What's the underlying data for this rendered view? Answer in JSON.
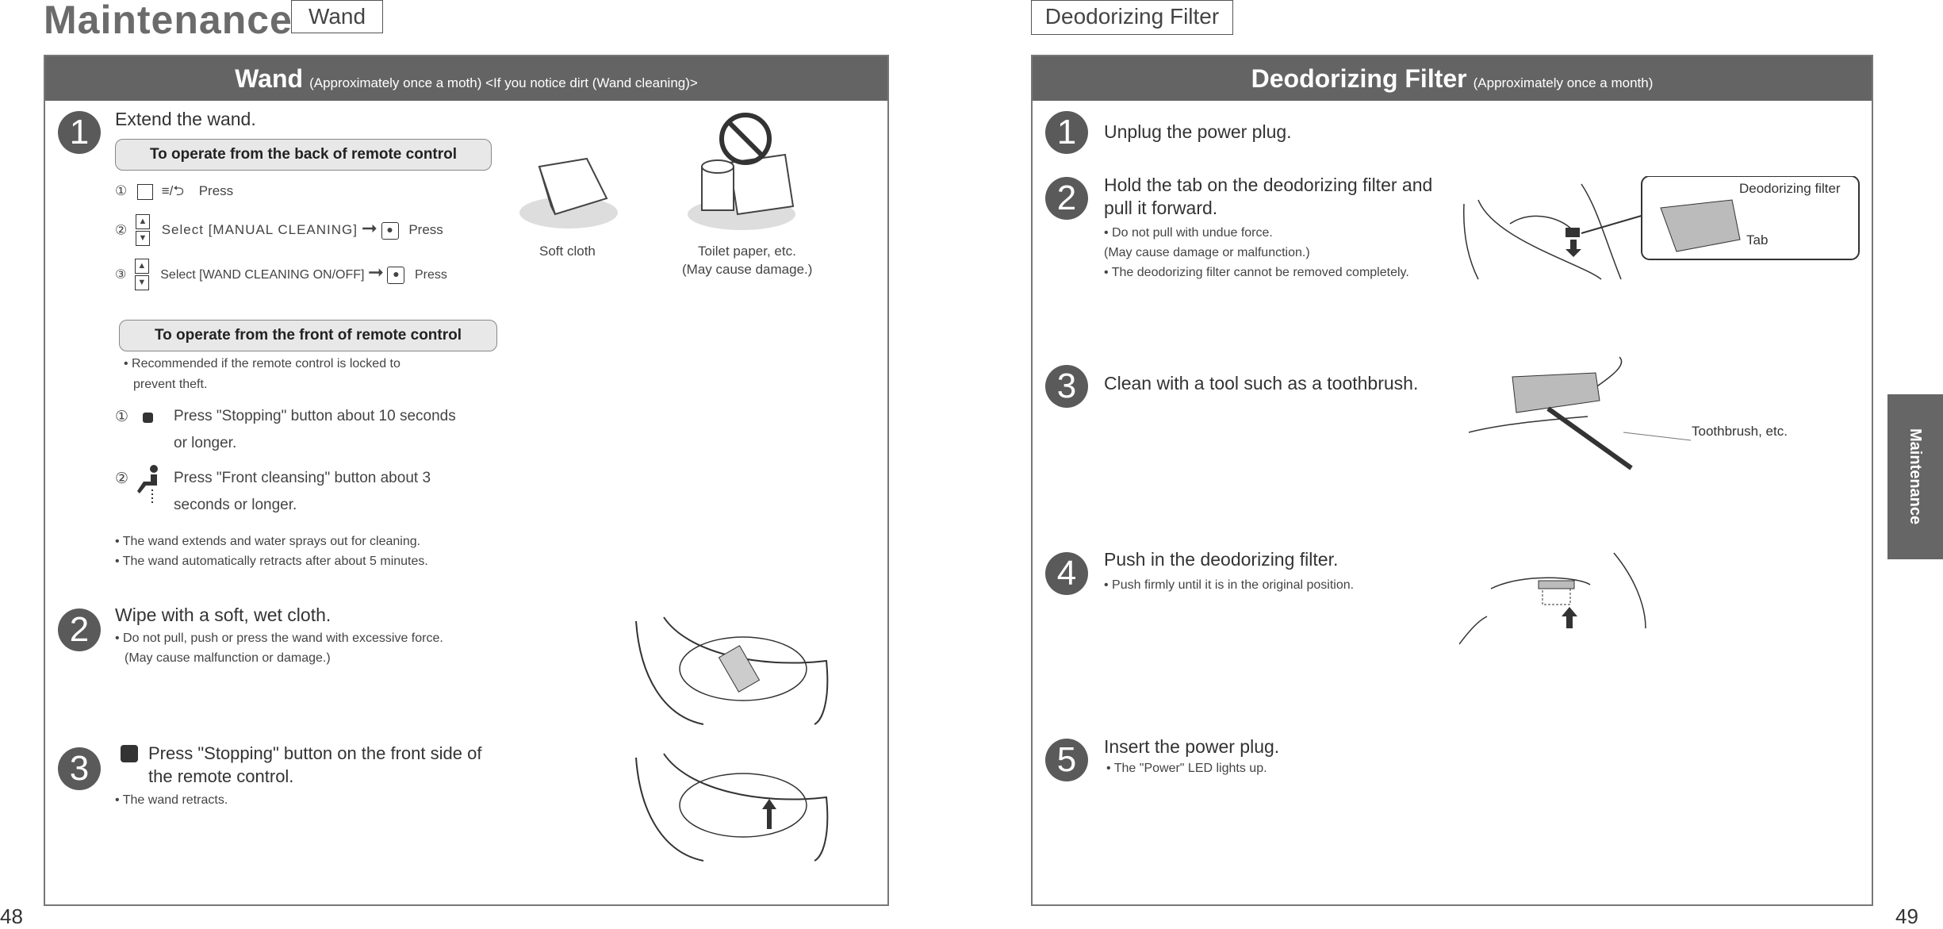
{
  "left_page": {
    "section_title": "Maintenance",
    "tag": "Wand",
    "page_number": "48",
    "header": {
      "title": "Wand",
      "subtitle": "(Approximately once a moth) <If you notice dirt (Wand cleaning)>"
    },
    "step1": {
      "number": "1",
      "title": "Extend the wand.",
      "back_pill": "To operate from the back of remote control",
      "back_rows": [
        {
          "marker": "①",
          "symbol": "≡/⮌",
          "text": "Press"
        },
        {
          "marker": "②",
          "text": "Select [MANUAL CLEANING]",
          "press": "Press"
        },
        {
          "marker": "③",
          "text": "Select [WAND CLEANING ON/OFF]",
          "press": "Press"
        }
      ],
      "soft_cloth_label": "Soft cloth",
      "toilet_paper_label": "Toilet paper, etc.",
      "toilet_paper_note": "(May cause damage.)",
      "front_pill": "To operate from the front of remote control",
      "front_note_1": "• Recommended if the remote control is locked to",
      "front_note_2": "prevent theft.",
      "front_rows": [
        {
          "marker": "①",
          "line1": "Press \"Stopping\" button about 10 seconds",
          "line2": "or longer."
        },
        {
          "marker": "②",
          "line1": "Press \"Front cleansing\" button about 3",
          "line2": "seconds or longer."
        }
      ],
      "bullets": [
        "• The wand extends and water sprays out for cleaning.",
        "• The wand automatically retracts after about 5 minutes."
      ]
    },
    "step2": {
      "number": "2",
      "title": "Wipe with a soft, wet cloth.",
      "bullet1": "• Do not pull, push or press the wand with excessive force.",
      "bullet2": "(May cause malfunction or damage.)"
    },
    "step3": {
      "number": "3",
      "title_line1": "Press \"Stopping\" button on the front side of",
      "title_line2": "the remote control.",
      "bullet": "• The wand retracts."
    }
  },
  "right_page": {
    "tag": "Deodorizing Filter",
    "page_number": "49",
    "side_tab": "Maintenance",
    "header": {
      "title": "Deodorizing Filter",
      "subtitle": "(Approximately once a month)"
    },
    "steps": [
      {
        "number": "1",
        "title": "Unplug the power plug."
      },
      {
        "number": "2",
        "title_line1": "Hold the tab on the deodorizing filter and",
        "title_line2": "pull it forward.",
        "bullets": [
          "• Do not pull with undue force.",
          " (May cause damage or malfunction.)",
          "• The deodorizing filter cannot be removed completely."
        ],
        "callout_filter": "Deodorizing filter",
        "callout_tab": "Tab"
      },
      {
        "number": "3",
        "title": "Clean with a tool such as a toothbrush.",
        "label": "Toothbrush, etc."
      },
      {
        "number": "4",
        "title": "Push in the deodorizing filter.",
        "bullet": "• Push firmly until it is in the original position."
      },
      {
        "number": "5",
        "title": "Insert the power plug.",
        "bullet": "• The \"Power\" LED lights up."
      }
    ]
  }
}
